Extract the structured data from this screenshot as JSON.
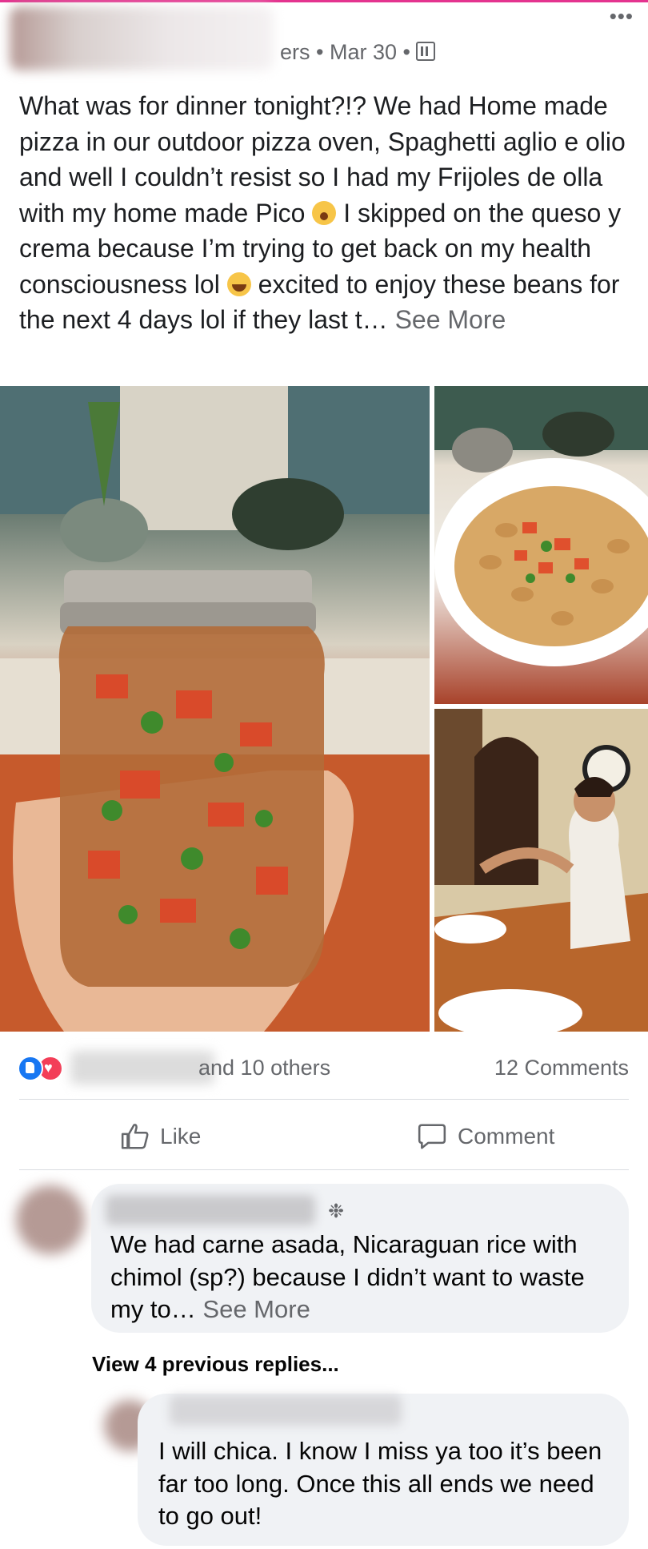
{
  "post": {
    "meta": "ers • Mar 30 •",
    "text_before_emoji1": "What was for dinner tonight?!? We had Home made pizza in our outdoor pizza oven, Spaghetti aglio e olio and well I couldn’t resist so I had my Frijoles de olla with my home made Pico ",
    "text_between_emojis": " I skipped on the queso y crema because I’m trying to get back on my health consciousness lol ",
    "text_after_emoji2": " excited to enjoy these beans for the next 4 days lol if they last t… ",
    "see_more": "See More",
    "emoji1": "face-with-hand-over-mouth-icon",
    "emoji2": "laughing-tears-icon"
  },
  "reactions": {
    "others_text": "and 10 others",
    "comments_count": "12 Comments"
  },
  "actions": {
    "like_label": "Like",
    "comment_label": "Comment"
  },
  "comments": [
    {
      "text": "We had carne asada, Nicaraguan rice with chimol (sp?) because I didn’t want to waste my to… ",
      "see_more": "See More"
    },
    {
      "text": "I will chica. I know I miss ya too it’s been far too long. Once this all ends we need to go out!"
    }
  ],
  "view_replies": "View 4 previous replies...",
  "colors": {
    "accent_top": "#e4338f",
    "like_blue": "#1877f2",
    "love_red": "#f33e58",
    "secondary_text": "#65676b",
    "bubble_bg": "#f0f2f5"
  }
}
